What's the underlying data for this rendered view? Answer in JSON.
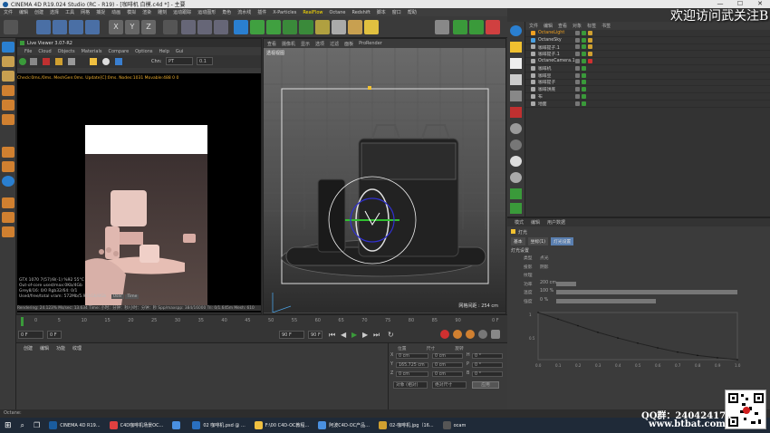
{
  "titlebar": {
    "title": "CINEMA 4D R19.024 Studio (RC - R19) - [咖啡机 白模.c4d *] - 主要",
    "min": "—",
    "max": "☐",
    "close": "✕"
  },
  "menubar": [
    "文件",
    "编辑",
    "创建",
    "选择",
    "工具",
    "网格",
    "捕捉",
    "动画",
    "模拟",
    "渲染",
    "雕刻",
    "运动跟踪",
    "运动图形",
    "角色",
    "流水线",
    "插件",
    "X-Particles",
    "RealFlow",
    "Octane",
    "Redshift",
    "脚本",
    "窗口",
    "帮助"
  ],
  "live_viewer": {
    "title": "Live Viewer 3.07-R2",
    "menu": [
      "File",
      "Cloud",
      "Objects",
      "Materials",
      "Compare",
      "Options",
      "Help",
      "Gui"
    ],
    "chn_label": "Chn:",
    "chn_value": "PT",
    "zoom": "0.1",
    "status_line": "Check:0ms./0ms. MeshGen:0ms. Update[C]:0ms. Nodes:1031 Movable:488 0 0",
    "info": [
      "GTX 1070 7(57)/8(-1)      %92      55°C",
      "Out-of-core used/max:0Kb/4Gb",
      "Grey8/16: 0/0          Rgb32/64: 0/1",
      "Used/free/total vram: 572Mb/5.911Gb/8Gb",
      "Rendering: 24.123%      Ms/sec: 13.634    Time: 小时：分钟：秒/小时：分钟：秒   Spp/maxspp: 384/16000   Tri: 0/1.645m  Mesh: 610"
    ],
    "user_label": "User",
    "time_label": "Time"
  },
  "viewport": {
    "menu": [
      "查看",
      "摄像机",
      "显示",
      "选项",
      "过滤",
      "面板",
      "ProRender"
    ],
    "label": "透视视图",
    "distance": "网格间距 : 254 cm"
  },
  "object_manager": {
    "tabs": [
      "文件",
      "编辑",
      "查看",
      "对象",
      "标签",
      "书签"
    ],
    "rows": [
      {
        "name": "OctaneLight",
        "selected": true,
        "color": "#f0a020"
      },
      {
        "name": "OctaneSky",
        "selected": false,
        "color": "#4a9fe0"
      },
      {
        "name": "咖啡提子.1",
        "selected": false,
        "color": "#aaaaaa"
      },
      {
        "name": "咖啡提子.1",
        "selected": false,
        "color": "#aaaaaa"
      },
      {
        "name": "OctaneCamera.1",
        "selected": false,
        "color": "#aaaaaa"
      },
      {
        "name": "咖啡机",
        "selected": false,
        "color": "#aaaaaa"
      },
      {
        "name": "咖啡豆",
        "selected": false,
        "color": "#aaaaaa"
      },
      {
        "name": "咖啡提子",
        "selected": false,
        "color": "#aaaaaa"
      },
      {
        "name": "咖啡饼底",
        "selected": false,
        "color": "#aaaaaa"
      },
      {
        "name": "布",
        "selected": false,
        "color": "#aaaaaa"
      },
      {
        "name": "地面",
        "selected": false,
        "color": "#aaaaaa"
      }
    ]
  },
  "attributes": {
    "tabs": [
      "模式",
      "编辑",
      "用户数据"
    ],
    "object": "灯光",
    "subtabs": [
      "基本",
      "坐标(1)",
      "灯光设置"
    ],
    "section": "灯光设置",
    "rows": [
      {
        "label": "类型",
        "value": "点光"
      },
      {
        "label": "投影",
        "value": "阴影"
      },
      {
        "label": "纹理",
        "value": ""
      },
      {
        "label": "功率",
        "value": "200 cm"
      },
      {
        "label": "温度",
        "value": "100 %"
      },
      {
        "label": "强度",
        "value": "0 %"
      }
    ],
    "graph_x_ticks": [
      "0.0",
      "0.1",
      "0.2",
      "0.3",
      "0.4",
      "0.5",
      "0.6",
      "0.7",
      "0.8",
      "0.9",
      "1.0"
    ],
    "graph_y_ticks": [
      "1",
      "0.5"
    ],
    "graph_points": [
      [
        0,
        1
      ],
      [
        0.1,
        0.86
      ],
      [
        0.2,
        0.72
      ],
      [
        0.3,
        0.58
      ],
      [
        0.4,
        0.46
      ],
      [
        0.5,
        0.35
      ],
      [
        0.6,
        0.25
      ],
      [
        0.7,
        0.16
      ],
      [
        0.8,
        0.09
      ],
      [
        0.9,
        0.04
      ],
      [
        1,
        0
      ]
    ]
  },
  "timeline": {
    "ruler": [
      "0",
      "5",
      "10",
      "15",
      "20",
      "25",
      "30",
      "35",
      "40",
      "45",
      "50",
      "55",
      "60",
      "65",
      "70",
      "75",
      "80",
      "85",
      "90"
    ],
    "start": "0 F",
    "current": "0 F",
    "end": "90 F",
    "end2": "90 F",
    "frame_indicator": "0 F"
  },
  "material_panel": {
    "tabs": [
      "创建",
      "编辑",
      "功能",
      "纹理"
    ]
  },
  "coords": {
    "headers": [
      "位置",
      "尺寸",
      "旋转"
    ],
    "rows": [
      {
        "axis": "X",
        "pos": "0 cm",
        "size": "0 cm",
        "rot_label": "H",
        "rot": "0 °"
      },
      {
        "axis": "Y",
        "pos": "165.725 cm",
        "size": "0 cm",
        "rot_label": "P",
        "rot": "0 °"
      },
      {
        "axis": "Z",
        "pos": "0 cm",
        "size": "0 cm",
        "rot_label": "B",
        "rot": "0 °"
      }
    ],
    "mode1": "对象 (相对)",
    "mode2": "绝对尺寸",
    "apply": "应用"
  },
  "statusbar": "Octane:",
  "taskbar": [
    {
      "label": "CINEMA 4D R19...",
      "color": "#1a5c9e"
    },
    {
      "label": "C4D咖啡机场景OC...",
      "color": "#e04040"
    },
    {
      "label": "",
      "color": "#4a90e0"
    },
    {
      "label": "02 咖啡机.psd @ ...",
      "color": "#2a70c0"
    },
    {
      "label": "F:\\00 C4D-OC教程...",
      "color": "#f0c040"
    },
    {
      "label": "阿波C4D-OC产品...",
      "color": "#4a90e0"
    },
    {
      "label": "02-咖啡机.jpg（16...",
      "color": "#d0a030"
    },
    {
      "label": "ocam",
      "color": "#555555"
    }
  ],
  "watermark": "欢迎访问武关注B",
  "qq": "QQ群：240424174",
  "site": "www.btbat.com"
}
